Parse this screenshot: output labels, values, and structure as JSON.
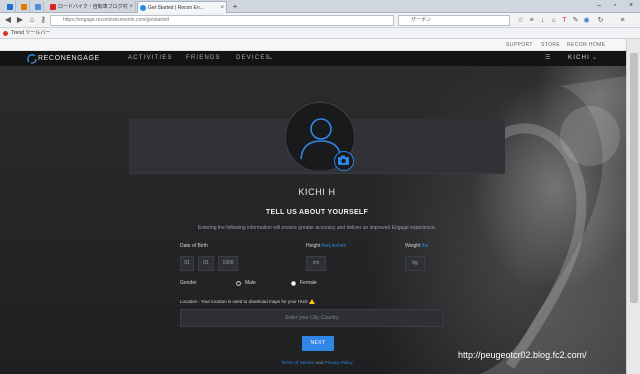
{
  "browser": {
    "tabs": [
      {
        "label": ""
      },
      {
        "label": ""
      },
      {
        "label": "ロードバイク・自転車ブログ村"
      },
      {
        "label": "Get Started | Recon En..."
      }
    ],
    "url": "https://engage.reconinstruments.com/getstarted",
    "search_placeholder": "ザーボン",
    "bookmark": "Trend ツールバー"
  },
  "site": {
    "utility_links": [
      "SUPPORT",
      "STORE",
      "RECON HOME"
    ],
    "logo": "RECONENGAGE",
    "nav": [
      "ACTIVITIES",
      "FRIENDS",
      "DEVICES"
    ],
    "user_menu": "KICHI",
    "profile_name": "KICHI H",
    "heading": "TELL US ABOUT YOURSELF",
    "subheading": "Entering the following information will ensure greater accuracy and deliver an improved Engage experience.",
    "dob_label": "Date of Birth",
    "dob": {
      "day": "01",
      "month": "01",
      "year": "1900"
    },
    "height_label": "Height",
    "height_unit": "feet,inches",
    "height_placeholder": "cm",
    "weight_label": "Weight",
    "weight_unit": "lbs",
    "weight_placeholder": "kg",
    "gender_label": "Gender",
    "gender_options": [
      "Male",
      "Female"
    ],
    "gender_selected": "Male",
    "location_label": "Location - Your location is used to download maps for your HUD",
    "location_placeholder": "Enter your City, Country",
    "next": "NEXT",
    "terms": "Terms of Service",
    "and": "and",
    "privacy": "Privacy Policy"
  },
  "watermark": "http://peugeotcr02.blog.fc2.com/",
  "colors": {
    "accent": "#2f86e6",
    "background": "#222325",
    "warning": "#f5c518"
  }
}
